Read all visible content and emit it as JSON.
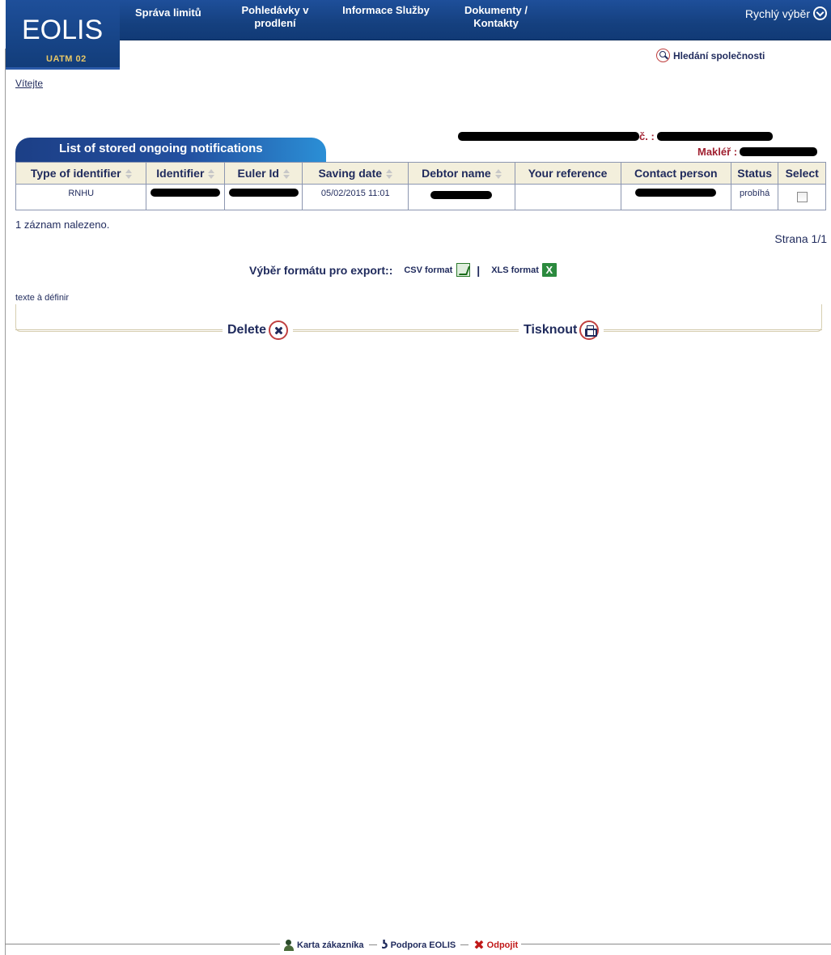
{
  "app": {
    "logo": "EOLIS",
    "environment": "UATM 02"
  },
  "nav": {
    "items": [
      {
        "label": "Správa limitů"
      },
      {
        "label": "Pohledávky v prodlení"
      },
      {
        "label": "Informace Služby"
      },
      {
        "label": "Dokumenty / Kontakty"
      }
    ],
    "quick_select": "Rychlý výběr"
  },
  "header": {
    "company_search": "Hledání společnosti",
    "welcome": "Vítejte",
    "company_suffix": "č. :",
    "broker_label": "Makléř :"
  },
  "list": {
    "tab_title": "List of stored ongoing notifications",
    "columns": [
      "Type of identifier",
      "Identifier",
      "Euler Id",
      "Saving date",
      "Debtor name",
      "Your reference",
      "Contact person",
      "Status",
      "Select"
    ],
    "rows": [
      {
        "type_of_identifier": "RNHU",
        "identifier": "",
        "euler_id": "",
        "saving_date": "05/02/2015 11:01",
        "debtor_name": "",
        "your_reference": "",
        "contact_person": "",
        "status": "probíhá",
        "selected": false
      }
    ],
    "records_found": "1 záznam nalezeno.",
    "page": "Strana 1/1"
  },
  "export": {
    "label": "Výběr formátu pro export::",
    "csv": "CSV format",
    "separator": "|",
    "xls": "XLS format",
    "xls_icon_letter": "X"
  },
  "note": "texte à définir",
  "actions": {
    "delete": "Delete",
    "print": "Tisknout"
  },
  "footer": {
    "customer_card": "Karta zákazníka",
    "support": "Podpora EOLIS",
    "logout": "Odpojit",
    "logout_glyph": "✖",
    "support_glyph": "ʖ"
  }
}
